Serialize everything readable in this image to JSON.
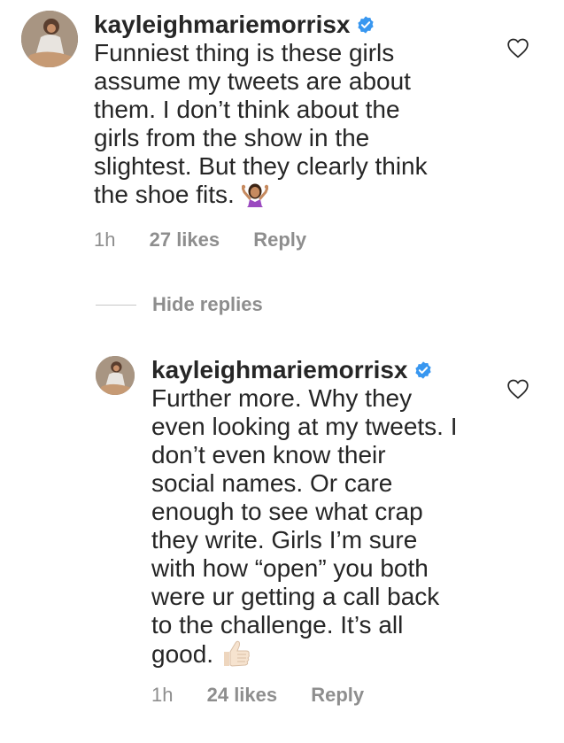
{
  "comments": [
    {
      "username": "kayleighmariemorrisx",
      "verified": true,
      "lines": [
        "Funniest thing is these girls",
        "assume my tweets are about",
        "them. I don’t think about the",
        "girls from the show in the",
        "slightest. But they clearly think",
        "the shoe fits."
      ],
      "emoji": "woman-shrugging-emoji",
      "time": "1h",
      "likes": "27 likes",
      "reply_label": "Reply"
    }
  ],
  "thread": {
    "hide_replies_label": "Hide replies"
  },
  "replies": [
    {
      "username": "kayleighmariemorrisx",
      "verified": true,
      "lines": [
        "Further more. Why they",
        "even looking at my tweets. I",
        "don’t even know their",
        "social names. Or care",
        "enough to see what crap",
        "they write. Girls I’m sure",
        "with how “open” you both",
        "were ur getting a call back",
        "to the challenge. It’s all",
        "good."
      ],
      "emoji": "thumbs-up-emoji",
      "time": "1h",
      "likes": "24 likes",
      "reply_label": "Reply"
    }
  ],
  "colors": {
    "text": "#262626",
    "secondary": "#8e8e8e",
    "verified": "#3897f0"
  }
}
